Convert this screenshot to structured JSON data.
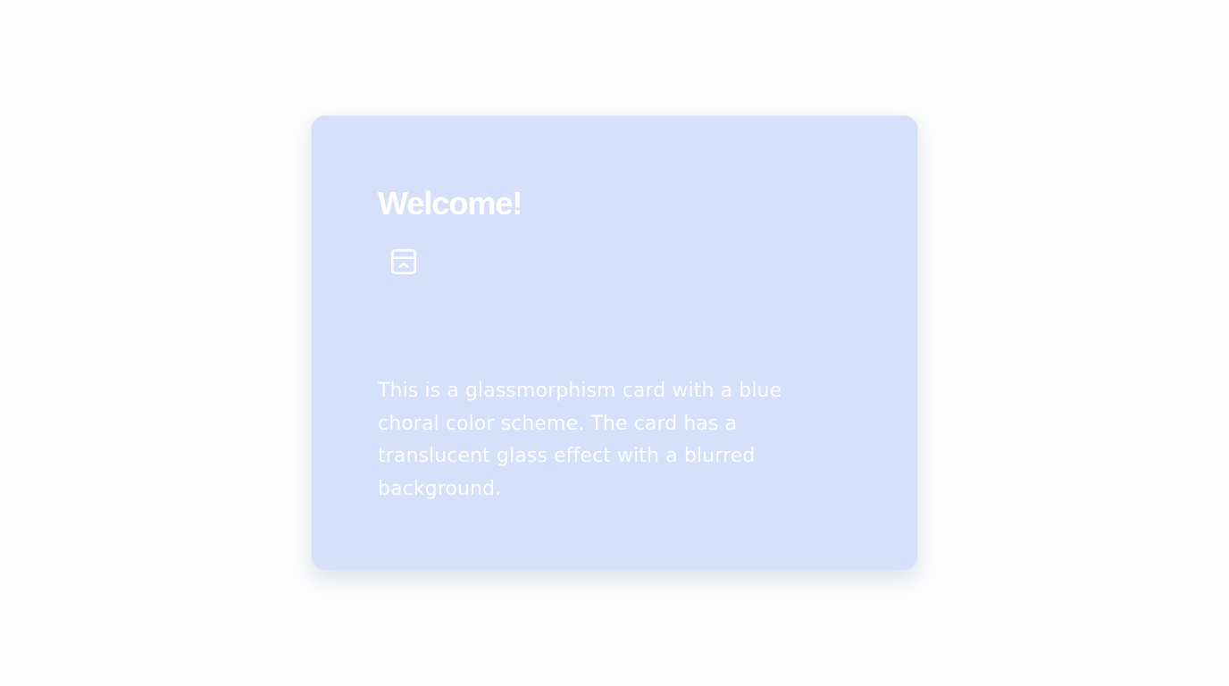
{
  "card": {
    "title": "Welcome!",
    "icon": "panel-top-chevron-up-icon",
    "body": "This is a glassmorphism card with a blue choral color scheme. The card has a translucent glass effect with a blurred background."
  },
  "colors": {
    "page_background": "#fdfdfe",
    "card_background": "#d7e0fa",
    "text": "#ffffff"
  }
}
